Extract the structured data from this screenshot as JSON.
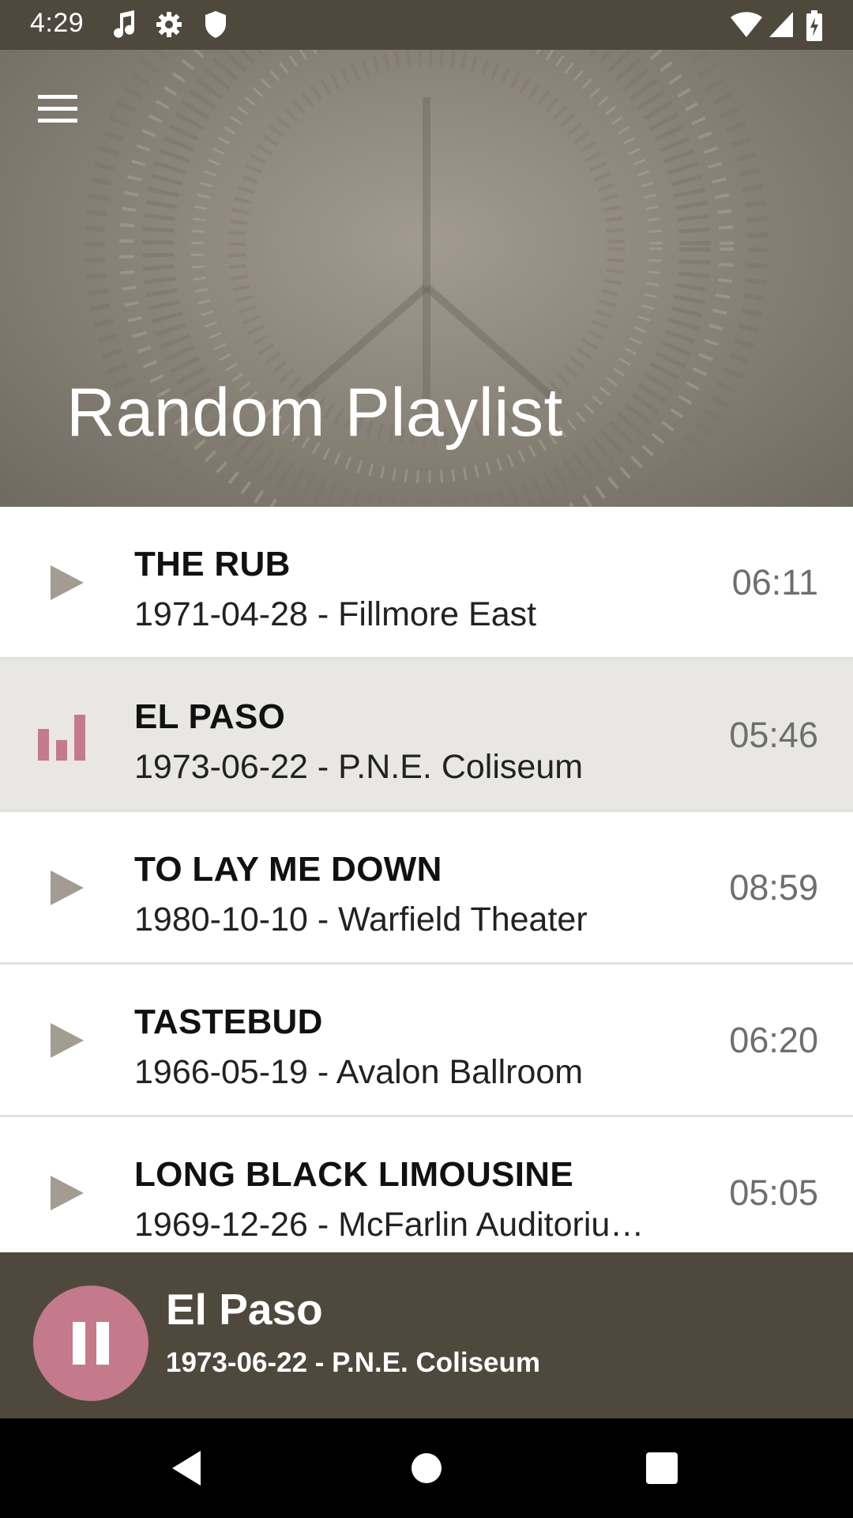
{
  "status_bar": {
    "time": "4:29",
    "icons": [
      "music-note-icon",
      "settings-icon",
      "shield-icon",
      "wifi-icon",
      "signal-icon",
      "battery-icon"
    ]
  },
  "header": {
    "title": "Random Playlist",
    "menu_icon": "menu-icon"
  },
  "tracks": [
    {
      "title": "THE RUB",
      "subtitle": "1971-04-28 - Fillmore East",
      "duration": "06:11",
      "state": "idle"
    },
    {
      "title": "EL PASO",
      "subtitle": "1973-06-22 - P.N.E. Coliseum",
      "duration": "05:46",
      "state": "playing"
    },
    {
      "title": "TO LAY ME DOWN",
      "subtitle": "1980-10-10 - Warfield Theater",
      "duration": "08:59",
      "state": "idle"
    },
    {
      "title": "TASTEBUD",
      "subtitle": "1966-05-19 - Avalon Ballroom",
      "duration": "06:20",
      "state": "idle"
    },
    {
      "title": "LONG BLACK LIMOUSINE",
      "subtitle": "1969-12-26 - McFarlin Auditoriu…",
      "duration": "05:05",
      "state": "idle"
    }
  ],
  "now_playing": {
    "title": "El Paso",
    "subtitle": "1973-06-22 - P.N.E. Coliseum",
    "control_icon": "pause-icon"
  },
  "colors": {
    "bar_dark": "#4f493d",
    "accent_pink": "#c47a8a",
    "play_icon": "#a39d91",
    "active_row": "#e8e7e4"
  },
  "nav_bar": {
    "icons": [
      "back-icon",
      "home-icon",
      "recents-icon"
    ]
  }
}
